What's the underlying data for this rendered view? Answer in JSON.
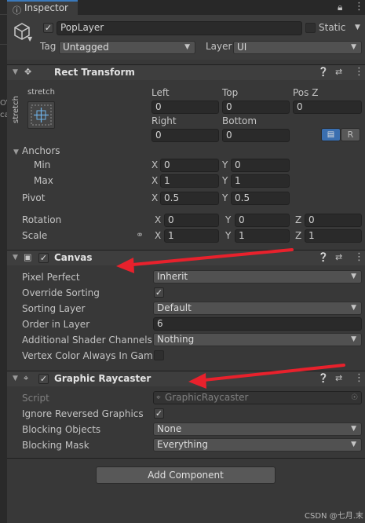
{
  "left_strip": {
    "chars": [
      "OV",
      "ca"
    ]
  },
  "tab": {
    "icon": "info-icon",
    "label": "Inspector"
  },
  "tab_actions": {
    "lock_icon": "lock-icon",
    "menu_icon": "kebab-menu-icon"
  },
  "gameobject": {
    "name": "PopLayer",
    "static_label": "Static",
    "tag_label": "Tag",
    "tag_value": "Untagged",
    "layer_label": "Layer",
    "layer_value": "UI"
  },
  "rect_transform": {
    "title": "Rect Transform",
    "anchor_preset_top": "stretch",
    "anchor_preset_side": "stretch",
    "left_label": "Left",
    "left_value": "0",
    "top_label": "Top",
    "top_value": "0",
    "posz_label": "Pos Z",
    "posz_value": "0",
    "right_label": "Right",
    "right_value": "0",
    "bottom_label": "Bottom",
    "bottom_value": "0",
    "raw_edit_label": "R",
    "anchors_label": "Anchors",
    "min_label": "Min",
    "min_x": "0",
    "min_y": "0",
    "max_label": "Max",
    "max_x": "1",
    "max_y": "1",
    "pivot_label": "Pivot",
    "pivot_x": "0.5",
    "pivot_y": "0.5",
    "rotation_label": "Rotation",
    "rot_x": "0",
    "rot_y": "0",
    "rot_z": "0",
    "scale_label": "Scale",
    "scale_x": "1",
    "scale_y": "1",
    "scale_z": "1",
    "axis_x": "X",
    "axis_y": "Y",
    "axis_z": "Z"
  },
  "canvas": {
    "title": "Canvas",
    "pixel_perfect_label": "Pixel Perfect",
    "pixel_perfect_value": "Inherit",
    "override_sorting_label": "Override Sorting",
    "override_sorting_checked": true,
    "sorting_layer_label": "Sorting Layer",
    "sorting_layer_value": "Default",
    "order_label": "Order in Layer",
    "order_value": "6",
    "shader_channels_label": "Additional Shader Channels",
    "shader_channels_value": "Nothing",
    "vertex_color_label": "Vertex Color Always In Gamm"
  },
  "graphic_raycaster": {
    "title": "Graphic Raycaster",
    "script_label": "Script",
    "script_value": "GraphicRaycaster",
    "ignore_reversed_label": "Ignore Reversed Graphics",
    "ignore_reversed_checked": true,
    "blocking_objects_label": "Blocking Objects",
    "blocking_objects_value": "None",
    "blocking_mask_label": "Blocking Mask",
    "blocking_mask_value": "Everything"
  },
  "add_component_label": "Add Component",
  "watermark": "CSDN @七月.末",
  "colors": {
    "annotation_arrow": "#e8212c",
    "accent_tab": "#3a79bb",
    "raw_edit_active": "#3a6fb0"
  }
}
